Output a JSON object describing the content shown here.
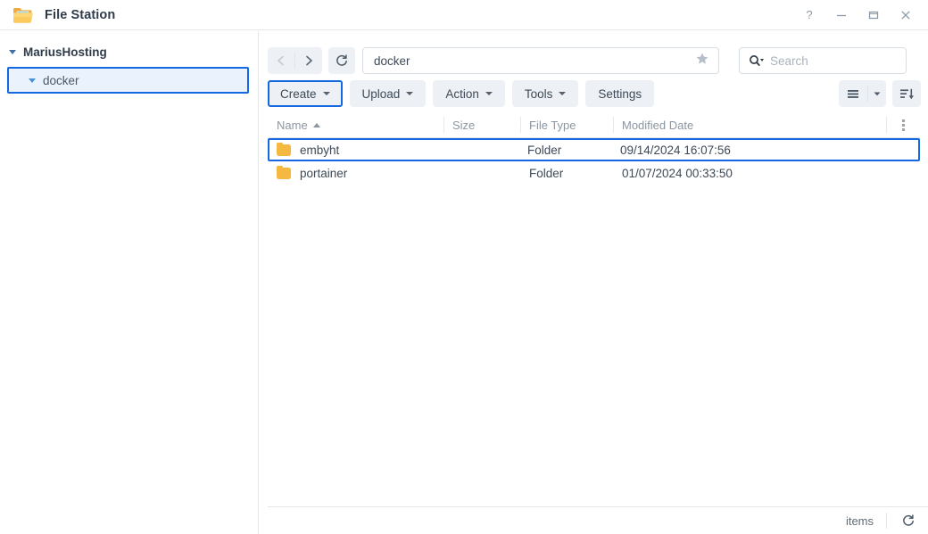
{
  "window": {
    "title": "File Station",
    "app_icon": "folder-icon",
    "controls": [
      {
        "name": "help-button",
        "glyph": "?"
      },
      {
        "name": "minimize-button",
        "glyph": "─"
      },
      {
        "name": "maximize-button",
        "glyph": "☐"
      },
      {
        "name": "close-button",
        "glyph": "✕"
      }
    ]
  },
  "sidebar": {
    "root": {
      "label": "MariusHosting",
      "expanded": true
    },
    "items": [
      {
        "label": "docker",
        "expanded": true,
        "selected": true
      }
    ]
  },
  "navigation": {
    "back_icon": "chevron-left-icon",
    "forward_icon": "chevron-right-icon",
    "refresh_icon": "refresh-icon",
    "path_value": "docker",
    "favorite_icon": "star-icon"
  },
  "search": {
    "icon": "search-icon",
    "placeholder": "Search",
    "value": ""
  },
  "toolbar": {
    "buttons": [
      {
        "label": "Create",
        "dropdown": true,
        "highlighted": true
      },
      {
        "label": "Upload",
        "dropdown": true,
        "highlighted": false
      },
      {
        "label": "Action",
        "dropdown": true,
        "highlighted": false
      },
      {
        "label": "Tools",
        "dropdown": true,
        "highlighted": false
      },
      {
        "label": "Settings",
        "dropdown": false,
        "highlighted": false
      }
    ],
    "view_mode_icon": "list-view-icon",
    "view_mode_dropdown_icon": "chevron-down-icon",
    "sort_icon": "sort-descending-icon"
  },
  "table": {
    "columns": [
      {
        "key": "name",
        "label": "Name",
        "sort": "asc"
      },
      {
        "key": "size",
        "label": "Size",
        "sort": ""
      },
      {
        "key": "type",
        "label": "File Type",
        "sort": ""
      },
      {
        "key": "date",
        "label": "Modified Date",
        "sort": ""
      }
    ],
    "menu_icon": "column-options-icon",
    "rows": [
      {
        "icon": "folder-icon",
        "name": "embyht",
        "size": "",
        "type": "Folder",
        "date": "09/14/2024 16:07:56",
        "selected": true
      },
      {
        "icon": "folder-icon",
        "name": "portainer",
        "size": "",
        "type": "Folder",
        "date": "01/07/2024 00:33:50",
        "selected": false
      }
    ]
  },
  "status": {
    "items_label": "items",
    "refresh_icon": "refresh-icon"
  },
  "colors": {
    "accent_highlight": "#1569e0",
    "folder": "#f5b942",
    "toolbar_button": "#edf1f5",
    "text": "#3d4956",
    "muted_text": "#8b96a2"
  }
}
